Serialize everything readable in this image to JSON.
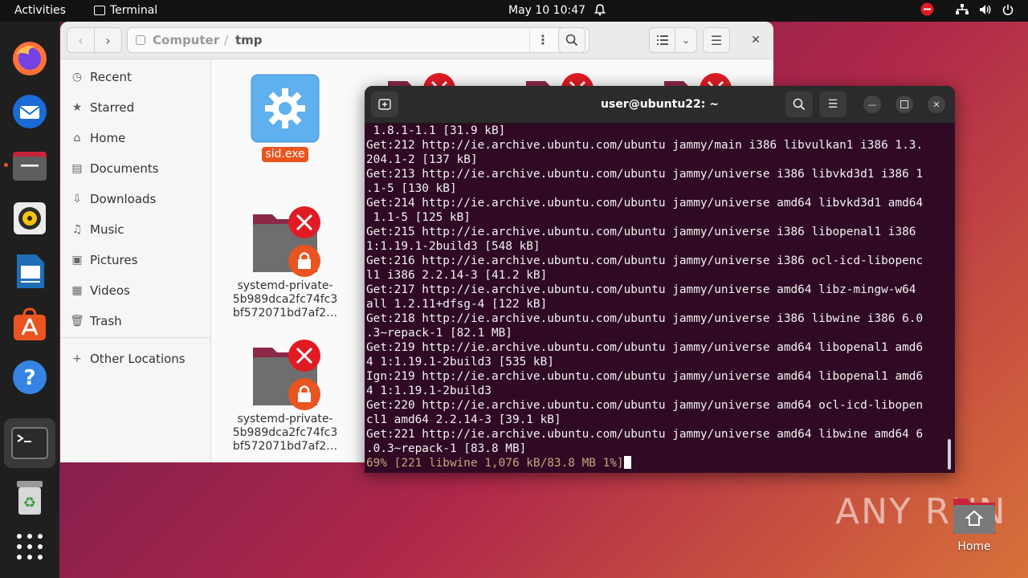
{
  "topbar": {
    "activities": "Activities",
    "app_name": "Terminal",
    "clock": "May 10  10:47"
  },
  "files": {
    "path": [
      "Computer",
      "/",
      "tmp"
    ],
    "sidebar": [
      {
        "icon": "clock-icon",
        "label": "Recent"
      },
      {
        "icon": "star-icon",
        "label": "Starred"
      },
      {
        "icon": "home-icon",
        "label": "Home"
      },
      {
        "icon": "document-icon",
        "label": "Documents"
      },
      {
        "icon": "download-icon",
        "label": "Downloads"
      },
      {
        "icon": "music-icon",
        "label": "Music"
      },
      {
        "icon": "picture-icon",
        "label": "Pictures"
      },
      {
        "icon": "video-icon",
        "label": "Videos"
      },
      {
        "icon": "trash-icon",
        "label": "Trash"
      },
      {
        "icon": "plus-icon",
        "label": "Other Locations"
      }
    ],
    "items": [
      {
        "name": "sid.exe",
        "selected": true
      },
      {
        "name_lines": [
          "systemd-private-",
          "5b989dca2fc74fc3",
          "bf572071bd7af2…"
        ]
      },
      {
        "name_lines": [
          "systemd-private-",
          "5b989dca2fc74fc3",
          "bf572071bd7af2…"
        ]
      }
    ]
  },
  "terminal": {
    "title": "user@ubuntu22: ~",
    "lines": [
      " 1.8.1-1.1 [31.9 kB]",
      "Get:212 http://ie.archive.ubuntu.com/ubuntu jammy/main i386 libvulkan1 i386 1.3.",
      "204.1-2 [137 kB]",
      "Get:213 http://ie.archive.ubuntu.com/ubuntu jammy/universe i386 libvkd3d1 i386 1",
      ".1-5 [130 kB]",
      "Get:214 http://ie.archive.ubuntu.com/ubuntu jammy/universe amd64 libvkd3d1 amd64",
      " 1.1-5 [125 kB]",
      "Get:215 http://ie.archive.ubuntu.com/ubuntu jammy/universe i386 libopenal1 i386",
      "1:1.19.1-2build3 [548 kB]",
      "Get:216 http://ie.archive.ubuntu.com/ubuntu jammy/universe i386 ocl-icd-libopenc",
      "l1 i386 2.2.14-3 [41.2 kB]",
      "Get:217 http://ie.archive.ubuntu.com/ubuntu jammy/universe amd64 libz-mingw-w64",
      "all 1.2.11+dfsg-4 [122 kB]",
      "Get:218 http://ie.archive.ubuntu.com/ubuntu jammy/universe i386 libwine i386 6.0",
      ".3~repack-1 [82.1 MB]",
      "Get:219 http://ie.archive.ubuntu.com/ubuntu jammy/universe amd64 libopenal1 amd6",
      "4 1:1.19.1-2build3 [535 kB]",
      "Ign:219 http://ie.archive.ubuntu.com/ubuntu jammy/universe amd64 libopenal1 amd6",
      "4 1:1.19.1-2build3",
      "Get:220 http://ie.archive.ubuntu.com/ubuntu jammy/universe amd64 ocl-icd-libopen",
      "cl1 amd64 2.2.14-3 [39.1 kB]",
      "Get:221 http://ie.archive.ubuntu.com/ubuntu jammy/universe amd64 libwine amd64 6",
      ".0.3~repack-1 [83.8 MB]"
    ],
    "progress_line": "69% [221 libwine 1,076 kB/83.8 MB 1%]"
  },
  "desktop": {
    "home_label": "Home",
    "watermark": "ANY RUN"
  },
  "colors": {
    "accent": "#e95420",
    "terminal_bg": "#300a24",
    "error_red": "#e01b24"
  }
}
